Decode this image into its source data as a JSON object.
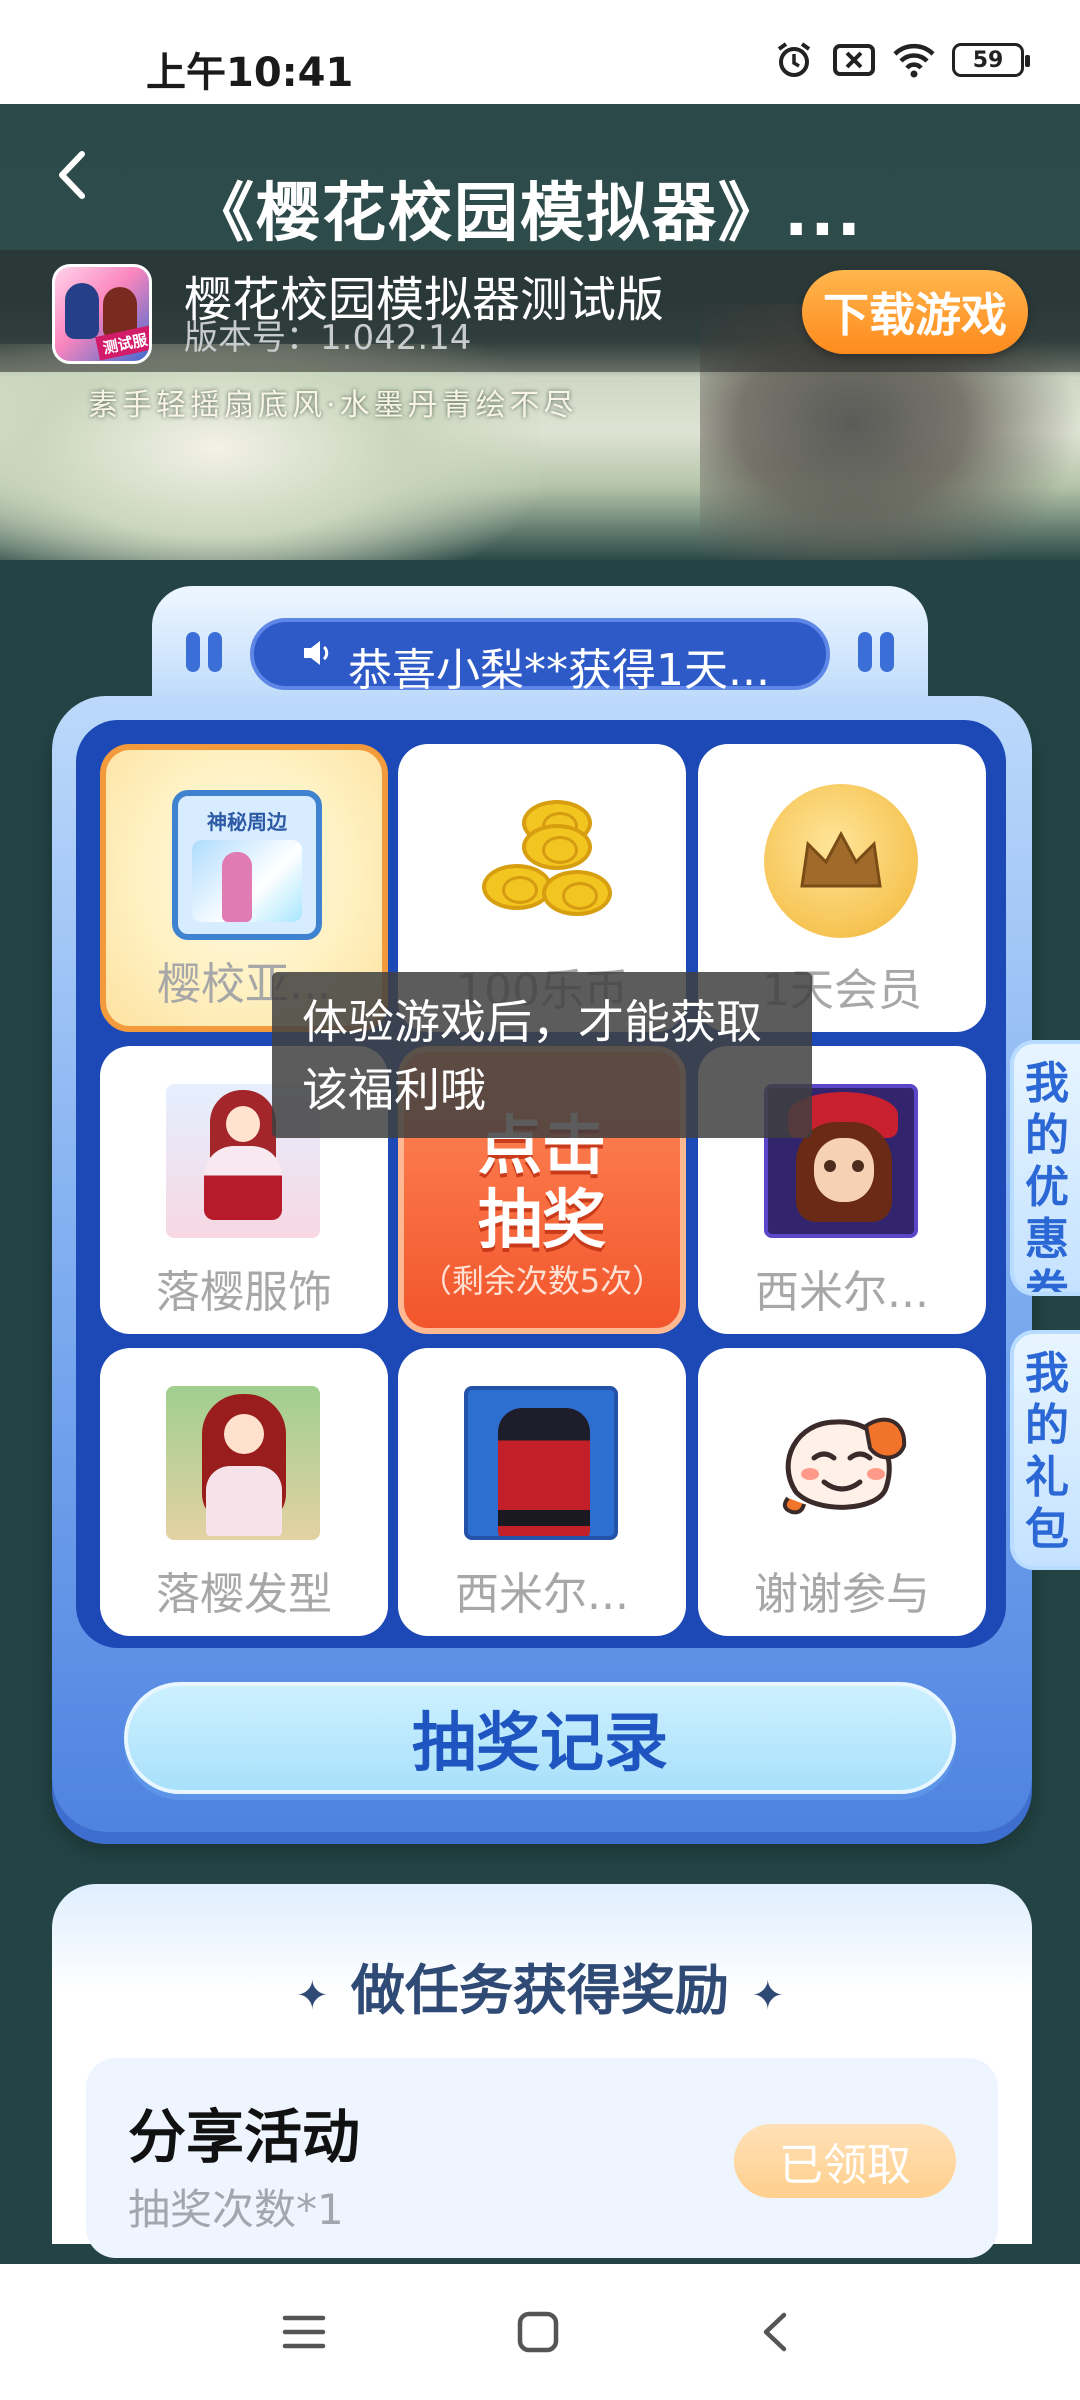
{
  "status_bar": {
    "time": "上午10:41",
    "battery": "59",
    "icons": [
      "alarm-icon",
      "sim-off-icon",
      "wifi-icon",
      "battery-icon"
    ]
  },
  "header": {
    "title": "《樱花校园模拟器》...",
    "banner_tagline": "素手轻摇扇底风·水墨丹青绘不尽"
  },
  "game": {
    "icon_badge": "测试服",
    "name": "樱花校园模拟器测试版",
    "version": "版本号：1.042.14",
    "download_label": "下载游戏"
  },
  "lottery": {
    "marquee": "恭喜小梨**获得1天...",
    "prizes": [
      {
        "label": "樱校亚...",
        "icon": "mystery-merch-icon"
      },
      {
        "label": "100乐币",
        "icon": "coins-icon"
      },
      {
        "label": "1天会员",
        "icon": "crown-icon"
      },
      {
        "label": "落樱服饰",
        "icon": "outfit-icon"
      },
      {
        "label": "西米尔...",
        "icon": "character-avatar-icon"
      },
      {
        "label": "落樱发型",
        "icon": "hairstyle-icon"
      },
      {
        "label": "西米尔...",
        "icon": "dress-icon"
      },
      {
        "label": "谢谢参与",
        "icon": "thanks-face-icon"
      }
    ],
    "merch_card_tag": "神秘周边",
    "draw_button": {
      "line1": "点击",
      "line2": "抽奖",
      "remaining": "（剩余次数5次）"
    },
    "records_label": "抽奖记录"
  },
  "toast": {
    "text": "体验游戏后，才能获取该福利哦"
  },
  "side_tabs": {
    "coupons": "我的优惠券",
    "gifts": "我的礼包"
  },
  "tasks": {
    "heading": "做任务获得奖励",
    "items": [
      {
        "title": "分享活动",
        "reward": "抽奖次数*1",
        "status": "已领取"
      }
    ]
  },
  "colors": {
    "background": "#234344",
    "accent_orange": "#ff8b1d",
    "lottery_blue": "#1c49b6",
    "text_blue": "#1f55c0"
  }
}
